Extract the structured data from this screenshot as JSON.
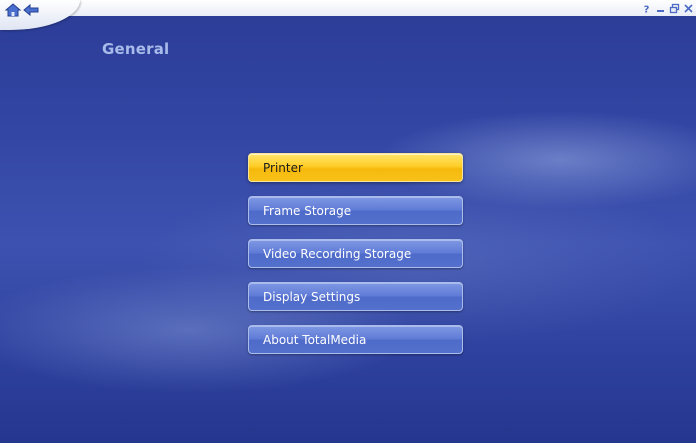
{
  "header": {
    "title": "General"
  },
  "nav": {
    "home_icon": "home-icon",
    "back_icon": "back-arrow-icon"
  },
  "window_controls": {
    "icons": [
      "help-icon",
      "minimize-icon",
      "restore-icon",
      "close-icon"
    ]
  },
  "menu": {
    "selected_index": 0,
    "items": [
      {
        "label": "Printer"
      },
      {
        "label": "Frame Storage"
      },
      {
        "label": "Video Recording Storage"
      },
      {
        "label": "Display Settings"
      },
      {
        "label": "About TotalMedia"
      }
    ]
  },
  "colors": {
    "background": "#3346a4",
    "title": "#a8bbea",
    "button": "#5f7bd6",
    "button_selected": "#ffce2a",
    "button_text": "#ffffff",
    "button_selected_text": "#1b1b1b"
  }
}
